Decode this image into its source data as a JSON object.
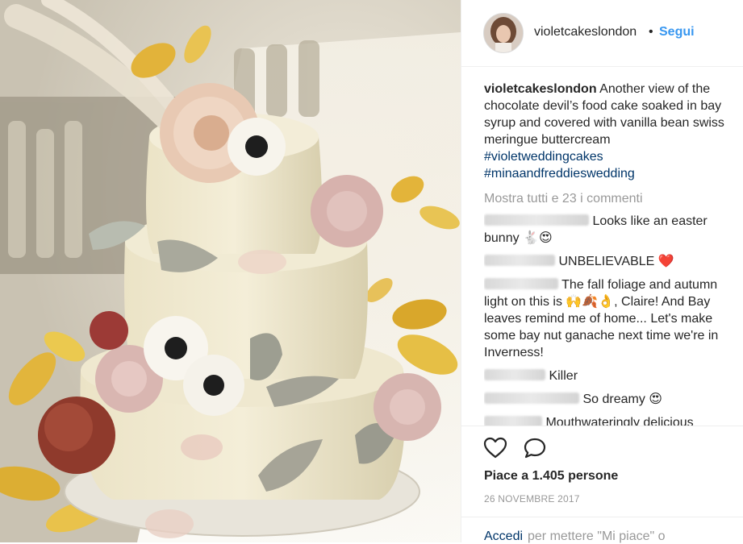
{
  "post": {
    "username": "violetcakeslondon",
    "separator": "•",
    "follow_label": "Segui",
    "caption": {
      "username": "violetcakeslondon",
      "text": "Another view of the chocolate devil’s food cake soaked in bay syrup and covered with vanilla bean swiss meringue buttercream",
      "hashtags": [
        "#violetweddingcakes",
        "#minaandfreddieswedding"
      ]
    },
    "load_more_label": "Mostra tutti e 23 i commenti",
    "comments": [
      {
        "text": "Looks like an easter bunny 🐇😍"
      },
      {
        "text": "UNBELIEVABLE ❤️"
      },
      {
        "text": "The fall foliage and autumn light on this is 🙌🍂👌, Claire! And Bay leaves remind me of home... Let's make some bay nut ganache next time we're in Inverness!"
      },
      {
        "text": "Killer"
      },
      {
        "text": "So dreamy 😍"
      },
      {
        "text": "Mouthwateringly delicious"
      }
    ],
    "likes_label": "Piace a 1.405 persone",
    "date": "26 NOVEMBRE 2017",
    "login_link": "Accedi",
    "login_text": "per mettere \"Mi piace\" o"
  },
  "icons": {
    "like": "heart-outline-icon",
    "comment": "speech-bubble-icon"
  },
  "colors": {
    "link_blue": "#3897f0",
    "hashtag_blue": "#003569",
    "muted_gray": "#999999",
    "text": "#262626",
    "border": "#efefef"
  }
}
